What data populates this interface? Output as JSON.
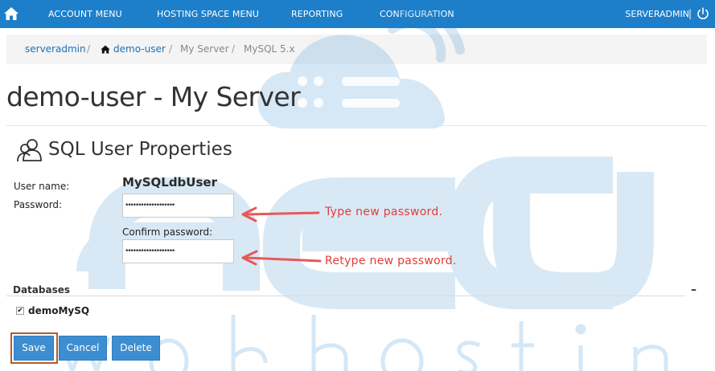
{
  "nav": {
    "home_icon": "home-icon",
    "items": [
      "ACCOUNT MENU",
      "HOSTING SPACE MENU",
      "REPORTING",
      "CONFIGURATION"
    ],
    "user": "SERVERADMIN",
    "separator": "|",
    "power_icon": "power-icon",
    "bar_color": "#1d7fca"
  },
  "breadcrumb": {
    "items": [
      {
        "label": "serveradmin",
        "link": true
      },
      {
        "label": "demo-user",
        "link": true,
        "icon": "house-icon"
      },
      {
        "label": "My Server",
        "link": false
      },
      {
        "label": "MySQL 5.x",
        "link": false
      }
    ],
    "separator": "/"
  },
  "page_title": "demo-user - My Server",
  "section": {
    "icon": "users-icon",
    "title": "SQL User Properties"
  },
  "form": {
    "username_label": "User name:",
    "username_value": "MySQLdbUser",
    "password_label": "Password:",
    "password_value": "•••••••••••••••••••",
    "confirm_label": "Confirm password:",
    "confirm_value": "•••••••••••••••••••"
  },
  "annotations": {
    "password_note": "Type new password.",
    "confirm_note": "Retype new password.",
    "color": "#e23c3c"
  },
  "databases": {
    "heading": "Databases",
    "collapse_symbol": "–",
    "items": [
      {
        "name": "demoMySQ",
        "checked": true,
        "check_mark": "✔"
      }
    ]
  },
  "buttons": {
    "save": "Save",
    "cancel": "Cancel",
    "delete": "Delete",
    "color": "#3d8ed0"
  },
  "watermark": {
    "brand": "aecu",
    "tagline": "web hosting",
    "color": "#1d7fca"
  }
}
